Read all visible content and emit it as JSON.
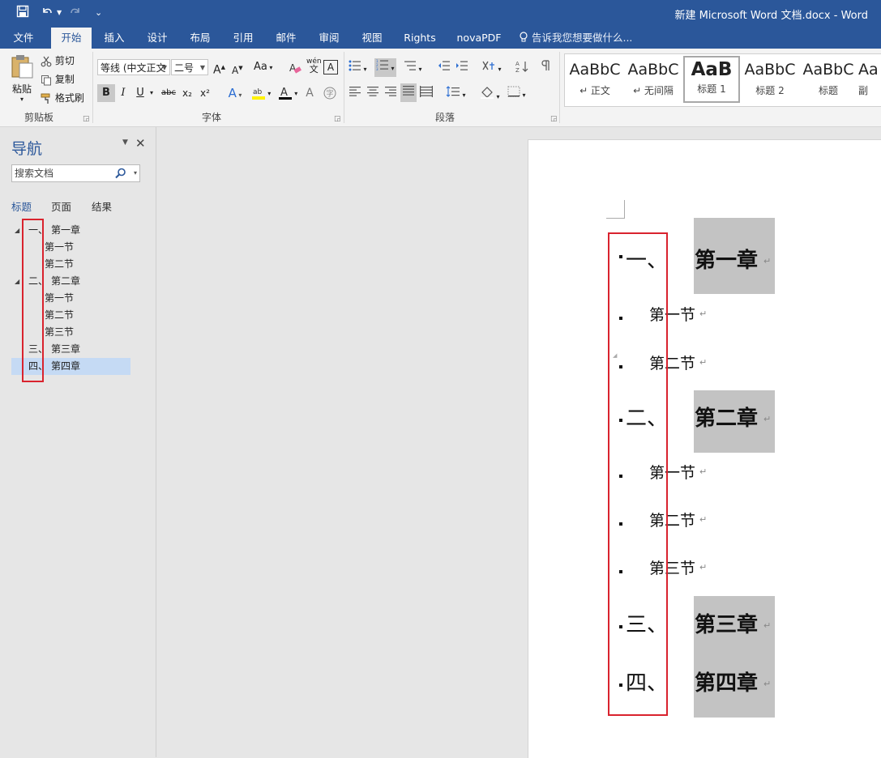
{
  "window": {
    "title": "新建 Microsoft Word 文档.docx - Word"
  },
  "tabs": [
    "文件",
    "开始",
    "插入",
    "设计",
    "布局",
    "引用",
    "邮件",
    "审阅",
    "视图",
    "Rights",
    "novaPDF"
  ],
  "active_tab": "开始",
  "tell_me": "告诉我您想要做什么...",
  "ribbon": {
    "clipboard": {
      "paste": "粘贴",
      "cut": "剪切",
      "copy": "复制",
      "format_painter": "格式刷",
      "label": "剪贴板"
    },
    "font": {
      "font_name": "等线 (中文正文",
      "font_size": "二号",
      "case_btn": "Aa",
      "label": "字体",
      "bold": "B",
      "italic": "I",
      "underline": "U",
      "strike": "abc",
      "sub": "x₂",
      "sup": "x²",
      "phonetic": "wén",
      "char_border": "A",
      "clear_fmt": "A"
    },
    "paragraph": {
      "label": "段落"
    },
    "styles": [
      {
        "sample": "AaBbC",
        "name": "↵ 正文"
      },
      {
        "sample": "AaBbC",
        "name": "↵ 无间隔"
      },
      {
        "sample": "AaB",
        "name": "标题 1"
      },
      {
        "sample": "AaBbC",
        "name": "标题 2"
      },
      {
        "sample": "AaBbC",
        "name": "标题"
      },
      {
        "sample": "Aa",
        "name": "副"
      }
    ]
  },
  "nav": {
    "title": "导航",
    "search_placeholder": "搜索文档",
    "tabs": [
      "标题",
      "页面",
      "结果"
    ],
    "active_tab": "标题",
    "tree": [
      {
        "num": "一、",
        "text": "第一章",
        "level": 1,
        "expanded": true
      },
      {
        "num": "",
        "text": "第一节",
        "level": 2
      },
      {
        "num": "",
        "text": "第二节",
        "level": 2
      },
      {
        "num": "二、",
        "text": "第二章",
        "level": 1,
        "expanded": true
      },
      {
        "num": "",
        "text": "第一节",
        "level": 2
      },
      {
        "num": "",
        "text": "第二节",
        "level": 2
      },
      {
        "num": "",
        "text": "第三节",
        "level": 2
      },
      {
        "num": "三、",
        "text": "第三章",
        "level": 1
      },
      {
        "num": "四、",
        "text": "第四章",
        "level": 1,
        "selected": true
      }
    ]
  },
  "document": {
    "paragraph_mark": "↵",
    "lines": [
      {
        "num": "一、",
        "text": "第一章",
        "level": 1
      },
      {
        "num": "",
        "text": "第一节",
        "level": 2
      },
      {
        "num": "",
        "text": "第二节",
        "level": 2
      },
      {
        "num": "二、",
        "text": "第二章",
        "level": 1
      },
      {
        "num": "",
        "text": "第一节",
        "level": 2
      },
      {
        "num": "",
        "text": "第二节",
        "level": 2
      },
      {
        "num": "",
        "text": "第三节",
        "level": 2
      },
      {
        "num": "三、",
        "text": "第三章",
        "level": 1
      },
      {
        "num": "四、",
        "text": "第四章",
        "level": 1
      }
    ]
  },
  "colors": {
    "accent": "#2b579a",
    "highlight_box": "#d9232e",
    "heading_shading": "#c3c3c3"
  }
}
